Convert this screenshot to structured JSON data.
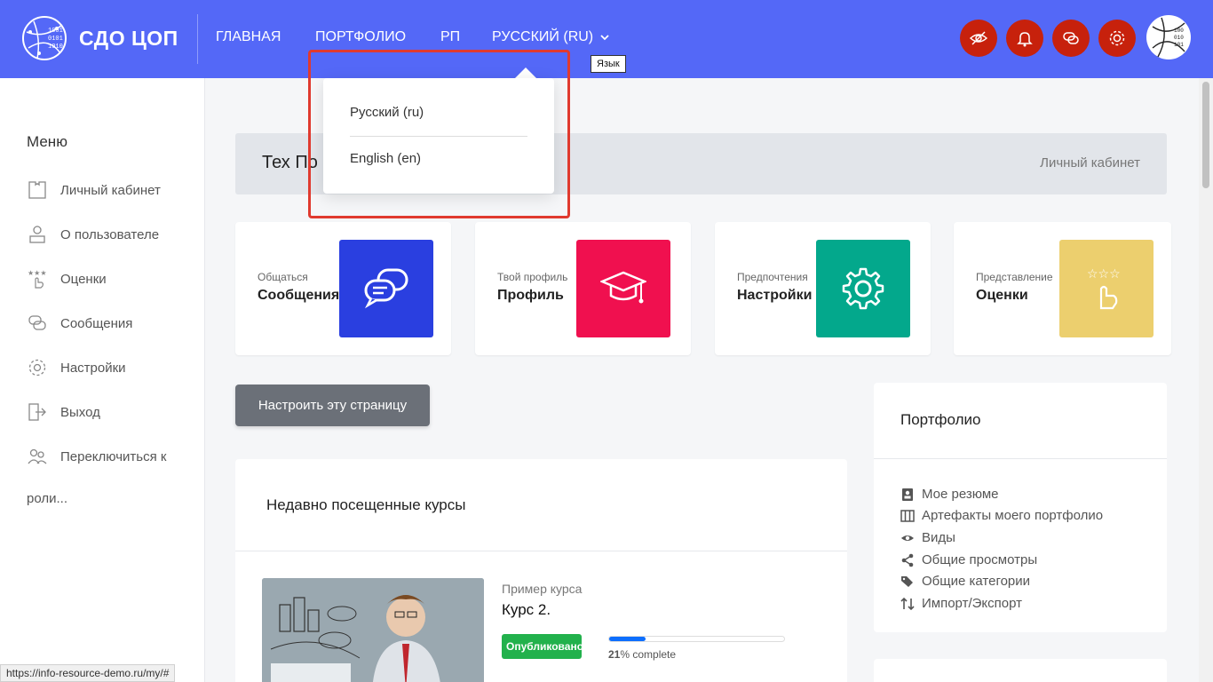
{
  "header": {
    "brand": "СДО ЦОП",
    "nav": {
      "home": "ГЛАВНАЯ",
      "portfolio": "ПОРТФОЛИО",
      "rp": "РП",
      "language": "РУССКИЙ (RU)"
    },
    "tooltip": "Язык",
    "accent_color": "#5468f7",
    "action_color": "#c7210c",
    "action_icons": [
      "eye-off-icon",
      "bell-icon",
      "chat-icon",
      "gear-icon"
    ]
  },
  "language_menu": {
    "items": [
      "Русский (ru)",
      "English (en)"
    ]
  },
  "sidebar": {
    "title": "Меню",
    "items": [
      {
        "label": "Личный кабинет",
        "icon": "puzzle-icon"
      },
      {
        "label": "О пользователе",
        "icon": "user-desk-icon"
      },
      {
        "label": "Оценки",
        "icon": "stars-hand-icon"
      },
      {
        "label": "Сообщения",
        "icon": "chat-icon"
      },
      {
        "label": "Настройки",
        "icon": "gear-icon"
      },
      {
        "label": "Выход",
        "icon": "logout-icon"
      },
      {
        "label": "Переключиться к",
        "icon": "users-icon"
      }
    ],
    "roles_suffix": "роли..."
  },
  "page": {
    "title": "Тех По",
    "breadcrumb": "Личный кабинет"
  },
  "cards": [
    {
      "sub": "Общаться",
      "title": "Сообщения",
      "color": "#2a3fe0",
      "icon": "chat-icon"
    },
    {
      "sub": "Твой профиль",
      "title": "Профиль",
      "color": "#f0104f",
      "icon": "graduation-cap-icon"
    },
    {
      "sub": "Предпочтения",
      "title": "Настройки",
      "color": "#03a88c",
      "icon": "gear-icon"
    },
    {
      "sub": "Представление",
      "title": "Оценки",
      "color": "#eccf6e",
      "icon": "stars-hand-icon"
    }
  ],
  "customize_button": "Настроить эту страницу",
  "recent": {
    "title": "Недавно посещенные курсы",
    "course": {
      "category": "Пример курса",
      "name": "Курс 2.",
      "badge": "Опубликовано",
      "progress": 21,
      "progress_pct": "21",
      "progress_suffix": "% complete"
    }
  },
  "portfolio": {
    "title": "Портфолио",
    "items": [
      {
        "label": "Мое резюме",
        "icon": "contact-card-icon"
      },
      {
        "label": "Артефакты моего портфолио",
        "icon": "archive-icon"
      },
      {
        "label": "Виды",
        "icon": "eye-icon"
      },
      {
        "label": "Общие просмотры",
        "icon": "share-icon"
      },
      {
        "label": "Общие категории",
        "icon": "tags-icon"
      },
      {
        "label": "Импорт/Экспорт",
        "icon": "sort-arrows-icon"
      }
    ]
  },
  "status_bar": {
    "url": "https://info-resource-demo.ru/my/#"
  }
}
